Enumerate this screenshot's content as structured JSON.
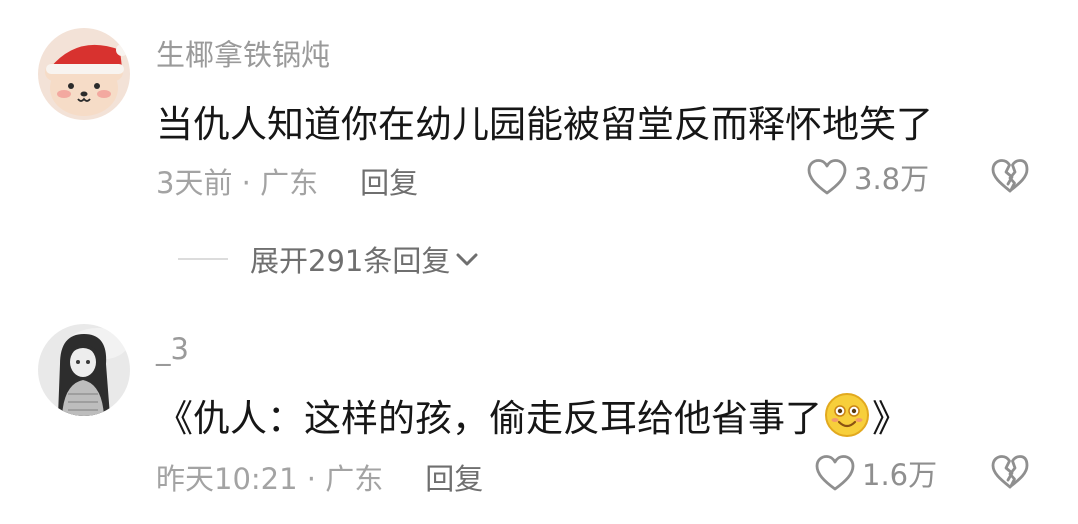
{
  "comments": [
    {
      "username": "生椰拿铁锅炖",
      "text": "当仇人知道你在幼儿园能被留堂反而释怀地笑了",
      "time_location": "3天前 · 广东",
      "reply_label": "回复",
      "like_count": "3.8万",
      "expand_label": "展开291条回复",
      "avatar_icon": "bear-santa-hat-avatar"
    },
    {
      "username": "_3",
      "text_before_emoji": "《仇人：这样的孩，偷走反耳给他省事了",
      "emoji_icon": "smiling-emoji-icon",
      "text_after_emoji": "》",
      "time_location": "昨天10:21 · 广东",
      "reply_label": "回复",
      "like_count": "1.6万",
      "avatar_icon": "anime-girl-avatar"
    }
  ],
  "colors": {
    "background": "#ffffff",
    "username": "#9a9a9a",
    "text": "#161616",
    "meta": "#a3a3a3",
    "action": "#6f6f6f"
  }
}
